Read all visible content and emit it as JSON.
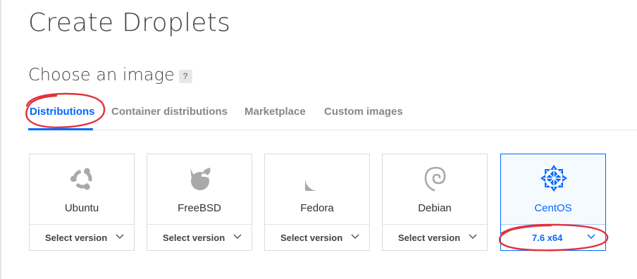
{
  "page": {
    "title": "Create Droplets"
  },
  "image_section": {
    "title": "Choose an image",
    "help_badge": "?"
  },
  "tabs": [
    {
      "label": "Distributions",
      "active": true
    },
    {
      "label": "Container distributions",
      "active": false
    },
    {
      "label": "Marketplace",
      "active": false
    },
    {
      "label": "Custom images",
      "active": false
    }
  ],
  "distributions": [
    {
      "name": "Ubuntu",
      "icon": "ubuntu-icon",
      "version": "Select version",
      "selected": false
    },
    {
      "name": "FreeBSD",
      "icon": "freebsd-icon",
      "version": "Select version",
      "selected": false
    },
    {
      "name": "Fedora",
      "icon": "fedora-icon",
      "version": "Select version",
      "selected": false
    },
    {
      "name": "Debian",
      "icon": "debian-icon",
      "version": "Select version",
      "selected": false
    },
    {
      "name": "CentOS",
      "icon": "centos-icon",
      "version": "7.6 x64",
      "selected": true
    }
  ],
  "colors": {
    "accent": "#0069ff",
    "annotation": "#e0323c",
    "muted_icon": "#a9a9a9"
  }
}
